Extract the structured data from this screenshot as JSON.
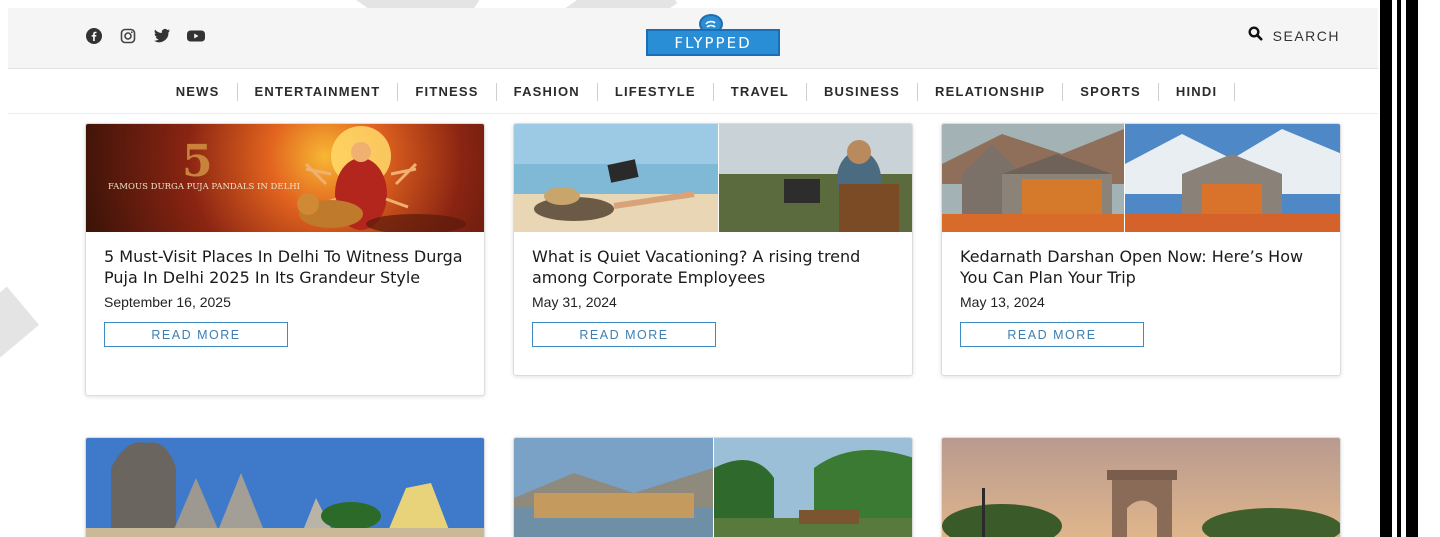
{
  "header": {
    "logo_text": "FLYPPED",
    "search_label": "SEARCH",
    "social_icons": [
      "facebook-icon",
      "instagram-icon",
      "twitter-icon",
      "youtube-icon"
    ]
  },
  "nav": {
    "items": [
      "NEWS",
      "ENTERTAINMENT",
      "FITNESS",
      "FASHION",
      "LIFESTYLE",
      "TRAVEL",
      "BUSINESS",
      "RELATIONSHIP",
      "SPORTS",
      "HINDI"
    ]
  },
  "articles": [
    {
      "title": "5 Must-Visit Places In Delhi To Witness Durga Puja In Delhi 2025 In Its Grandeur Style",
      "date": "September 16, 2025",
      "read_more": "READ MORE",
      "thumb_big": "5",
      "thumb_small": "FAMOUS DURGA PUJA PANDALS IN DELHI"
    },
    {
      "title": "What is Quiet Vacationing? A rising trend among Corporate Employees",
      "date": "May 31, 2024",
      "read_more": "READ MORE"
    },
    {
      "title": "Kedarnath Darshan Open Now: Here’s How You Can Plan Your Trip",
      "date": "May 13, 2024",
      "read_more": "READ MORE"
    }
  ],
  "colors": {
    "accent": "#3d8cc4",
    "logo_blue": "#2a8ed6",
    "topbar_bg": "#f5f5f5"
  }
}
